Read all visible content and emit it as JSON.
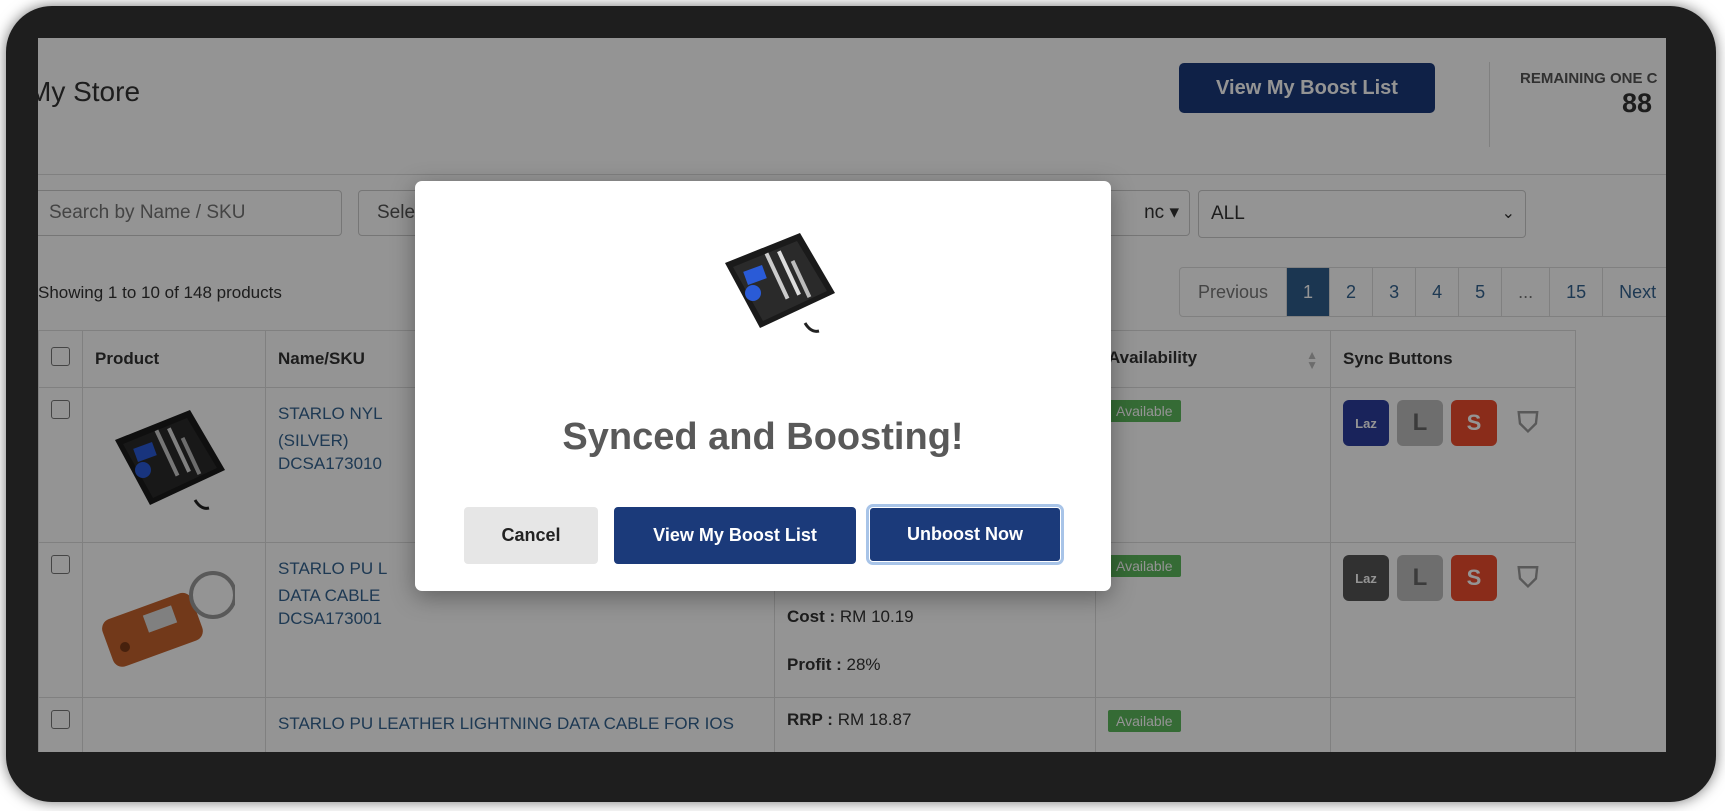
{
  "header": {
    "title": "My Store",
    "view_boost_list_label": "View My Boost List",
    "remaining_label": "REMAINING ONE C",
    "remaining_count": "88"
  },
  "filters": {
    "search_placeholder": "Search by Name / SKU",
    "select_label": "Sele",
    "sync_dropdown_label": "nc",
    "availability_value": "ALL"
  },
  "showing_text": "Showing 1 to 10 of 148 products",
  "pagination": {
    "previous": "Previous",
    "pages": [
      "1",
      "2",
      "3",
      "4",
      "5",
      "...",
      "15"
    ],
    "next": "Next",
    "active": "1"
  },
  "table": {
    "headers": {
      "product": "Product",
      "name_sku": "Name/SKU",
      "availability": "Availability",
      "sync_buttons": "Sync Buttons"
    },
    "rows": [
      {
        "name_line1": "STARLO NYL",
        "name_line2": "(SILVER)",
        "sku": "DCSA173010",
        "availability": "Available"
      },
      {
        "name_line1": "STARLO PU L",
        "name_line2": "DATA CABLE",
        "sku": "DCSA173001",
        "cost_label": "Cost :",
        "cost_value": "RM 10.19",
        "profit_label": "Profit :",
        "profit_value": "28%",
        "availability": "Available"
      },
      {
        "name_line1": "STARLO PU LEATHER LIGHTNING DATA CABLE FOR IOS",
        "rrp_label": "RRP :",
        "rrp_value": "RM 18.87",
        "availability": "Available"
      }
    ]
  },
  "sync_icons": {
    "lazada": "Laz",
    "l_mark": "L",
    "shopee": "S"
  },
  "modal": {
    "title": "Synced and Boosting!",
    "cancel_label": "Cancel",
    "view_boost_list_label": "View My Boost List",
    "unboost_label": "Unboost Now"
  },
  "colors": {
    "primary": "#1b3a7a",
    "pagination_active": "#2f5d8c",
    "available_badge": "#5cb85c",
    "shopee": "#ee4d2d",
    "lazada": "#2b3d9e"
  }
}
